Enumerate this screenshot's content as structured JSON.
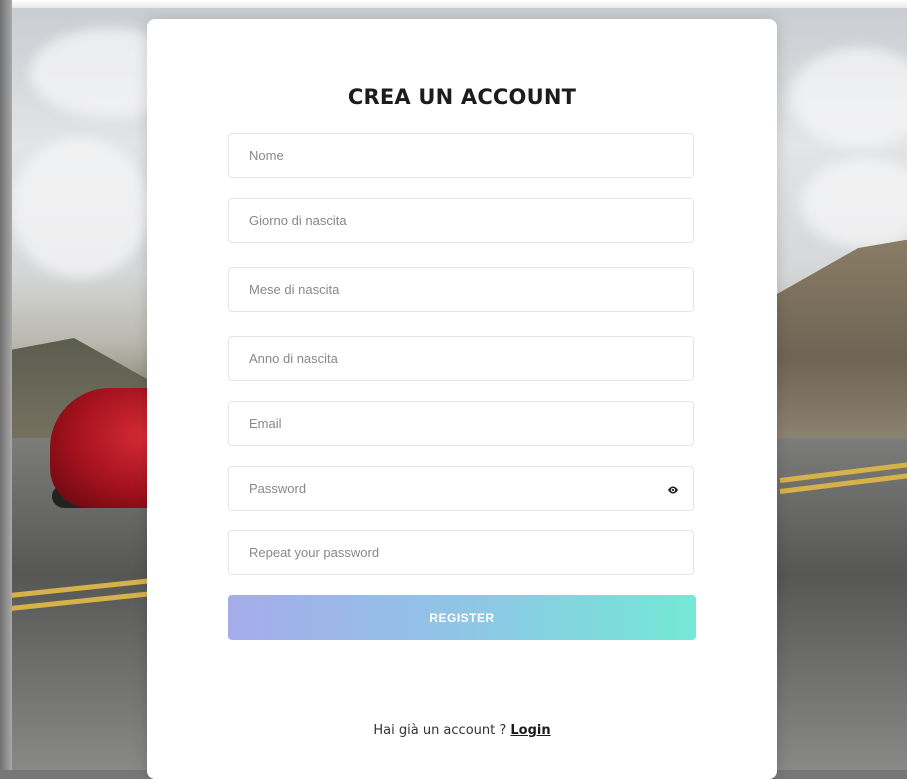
{
  "form": {
    "title": "CREA UN ACCOUNT",
    "fields": {
      "name": {
        "placeholder": "Nome",
        "value": ""
      },
      "birth_day": {
        "placeholder": "Giorno di nascita",
        "value": ""
      },
      "birth_month": {
        "placeholder": "Mese di nascita",
        "value": ""
      },
      "birth_year": {
        "placeholder": "Anno di nascita",
        "value": ""
      },
      "email": {
        "placeholder": "Email",
        "value": ""
      },
      "password": {
        "placeholder": "Password",
        "value": "",
        "toggle_icon": "eye-icon"
      },
      "repeat_password": {
        "placeholder": "Repeat your password",
        "value": ""
      }
    },
    "register_label": "REGISTER",
    "footer_text": "Hai già un account ? ",
    "login_link": "Login"
  },
  "colors": {
    "button_gradient_start": "#a6acea",
    "button_gradient_end": "#74e8d6",
    "card_background": "#ffffff"
  }
}
